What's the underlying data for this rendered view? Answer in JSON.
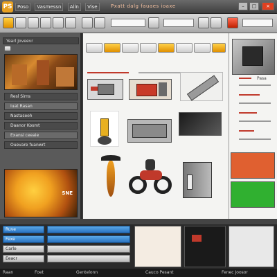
{
  "app": {
    "logo_label": "PS",
    "window_title": "Pxatt dalg fauaes ioaxe"
  },
  "menu": [
    "Poso",
    "Vasmessn",
    "Alln",
    "Vise"
  ],
  "toolbar": {
    "fields": [
      "",
      "",
      "",
      ""
    ]
  },
  "left_panel": {
    "header": "Yearl Joveevr",
    "rows": [
      "Resl Sirns",
      "Iuat Rasan",
      "Nastaseoh",
      "Daanor Kosmt",
      "Exansi ceeaie",
      "Ouevare fuanwrt"
    ],
    "preview_caption": "SNE"
  },
  "right_panel": {
    "header": "Pasa"
  },
  "bottom": {
    "tracks": [
      "Ruve",
      "Fexe",
      "Carlo",
      "Eeacr"
    ],
    "status_items": [
      "Raan",
      "Foet",
      "Gentelonn",
      "Cauco Pesant",
      "Fenec Joosor"
    ]
  },
  "colors": {
    "accent": "#e8a020",
    "selection": "#2a72c0",
    "marker": "#c0392b"
  }
}
